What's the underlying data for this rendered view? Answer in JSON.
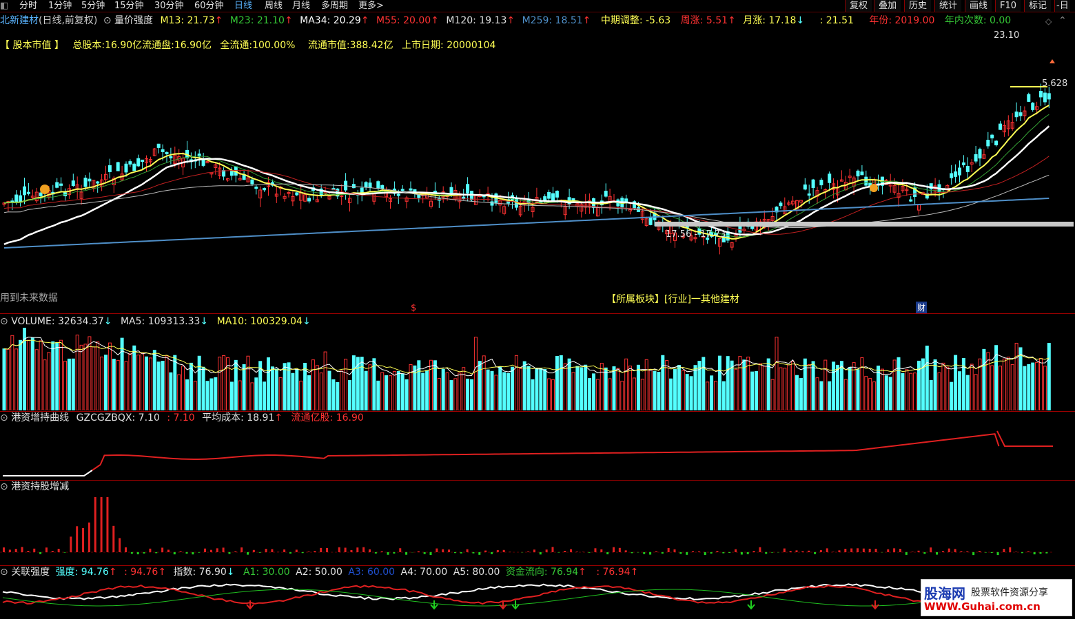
{
  "toolbar": {
    "periods": [
      "分时",
      "1分钟",
      "5分钟",
      "15分钟",
      "30分钟",
      "60分钟",
      "日线",
      "周线",
      "月线",
      "多周期",
      "更多>"
    ],
    "active_period": "日线",
    "right_buttons": [
      "复权",
      "叠加",
      "历史",
      "统计",
      "画线",
      "F10",
      "标记",
      "-日"
    ]
  },
  "price_header": {
    "stock": "北新建材",
    "mode": "(日线,前复权)",
    "indicator": "量价强度",
    "m13": "M13: 21.73",
    "m23": "M23: 21.10",
    "ma34": "MA34: 20.29",
    "m55": "M55: 20.00",
    "m120": "M120: 19.13",
    "m259": "M259: 18.51",
    "mid_adjust": "中期调整: -5.63",
    "week_rise": "周涨: 5.51",
    "month_rise": "月涨: 17.18",
    "blank_value": ": 21.51",
    "year": "年份: 2019.00",
    "year_count": "年内次数: 0.00",
    "arrow_up": "↑",
    "arrow_down": "↓"
  },
  "market_cap_line": {
    "bracket_label": "【 股本市值 】",
    "total_shares": "总股本:16.90亿",
    "float_shares": "流通盘:16.90亿",
    "full_float": "全流通:100.00%",
    "float_value": "流通市值:388.42亿",
    "listing_date": "上市日期: 20000104"
  },
  "chart_annotations": {
    "high_label": "23.10",
    "right_label": "5.628",
    "range_label": "17.56 - 17.73",
    "future_note": "用到未来数据",
    "sector": "【所属板块】[行业]一其他建材",
    "dollar": "$",
    "fin": "财"
  },
  "volume_header": {
    "volume": "VOLUME: 32634.37",
    "ma5": "MA5: 109313.33",
    "ma10": "MA10: 100329.04"
  },
  "hk_curve_header": {
    "title": "港资增持曲线",
    "gz": "GZCGZBQX: 7.10",
    "gz2": ": 7.10",
    "avg_cost": "平均成本: 18.91",
    "float_shares": "流通亿股: 16.90"
  },
  "hk_hold_header": {
    "title": "港资持股增减"
  },
  "strength_header": {
    "title": "关联强度",
    "strength": "强度: 94.76",
    "strength2": ": 94.76",
    "index": "指数: 76.90",
    "a1": "A1: 30.00",
    "a2": "A2: 50.00",
    "a3": "A3: 60.00",
    "a4": "A4: 70.00",
    "a5": "A5: 80.00",
    "fund_flow": "资金流向: 76.94",
    "fund_flow2": ": 76.94"
  },
  "watermark": {
    "brand": "股海网",
    "slogan": "股票软件资源分享",
    "url": "WWW.Guhai.com.cn"
  },
  "colors": {
    "up": "#ff3232",
    "down": "#54ffff",
    "ma_yellow": "#ffff54",
    "ma_white": "#ffffff",
    "ma_blue": "#4f8fc8",
    "accent_red": "#a00000"
  },
  "chart_data": {
    "type": "candlestick",
    "title": "北新建材 (日线,前复权)",
    "price_range_visible": [
      17.0,
      23.3
    ],
    "price_high_marked": 23.1,
    "price_range_marked": [
      17.56,
      17.73
    ],
    "volume_ma5": 109313.33,
    "volume_ma10": 100329.04,
    "last_volume": 32634.37,
    "ma_values": {
      "M13": 21.73,
      "M23": 21.1,
      "MA34": 20.29,
      "M55": 20.0,
      "M120": 19.13,
      "M259": 18.51
    },
    "hk_curve": {
      "GZCGZBQX": 7.1,
      "avg_cost": 18.91,
      "float_shares_yi": 16.9
    },
    "strength": {
      "strength": 94.76,
      "index": 76.9,
      "A1": 30.0,
      "A2": 50.0,
      "A3": 60.0,
      "A4": 70.0,
      "A5": 80.0,
      "fund_flow": 76.94
    }
  }
}
